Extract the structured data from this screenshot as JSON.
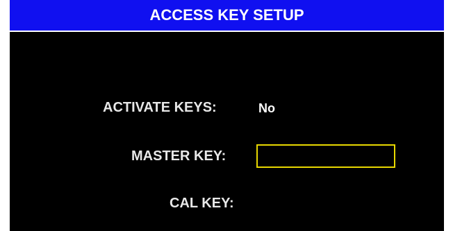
{
  "header": {
    "title": "ACCESS KEY SETUP"
  },
  "form": {
    "activate_keys": {
      "label": "ACTIVATE KEYS:",
      "value": "No"
    },
    "master_key": {
      "label": "MASTER KEY:",
      "value": ""
    },
    "cal_key": {
      "label": "CAL KEY:",
      "value": ""
    }
  },
  "colors": {
    "title_bar": "#1010f0",
    "background": "#000000",
    "field_border": "#e8d800",
    "text": "#e8e8e8"
  }
}
